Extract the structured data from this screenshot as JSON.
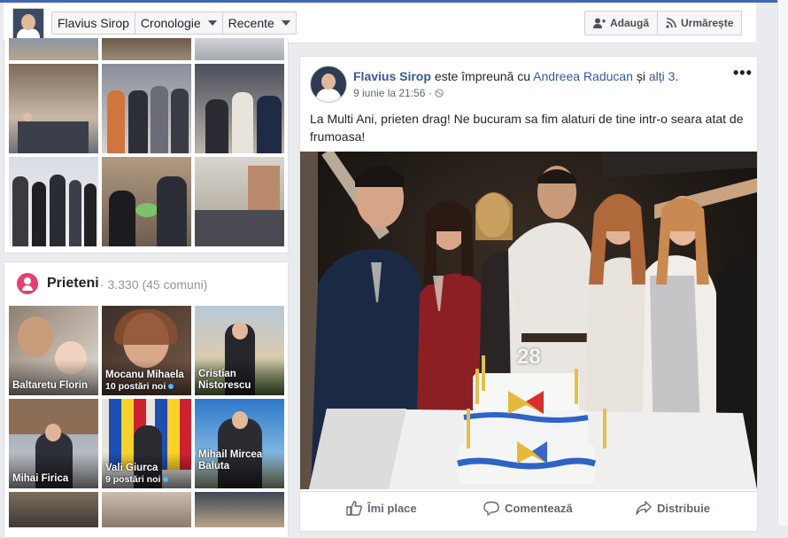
{
  "header": {
    "profile_name": "Flavius Sirop",
    "timeline_label": "Cronologie",
    "recent_label": "Recente",
    "add_friend_label": "Adaugă",
    "follow_label": "Urmărește"
  },
  "friends": {
    "title": "Prieteni",
    "count": "· 3.330 (45 comuni)",
    "items": [
      {
        "name": "Baltaretu Florin",
        "sub": ""
      },
      {
        "name": "Mocanu Mihaela",
        "sub": "10 postări noi"
      },
      {
        "name": "Cristian Nistorescu",
        "sub": ""
      },
      {
        "name": "Mihai Firica",
        "sub": ""
      },
      {
        "name": "Vali Giurca",
        "sub": "9 postări noi"
      },
      {
        "name": "Mihail Mircea Baluta",
        "sub": ""
      }
    ]
  },
  "post": {
    "author": "Flavius Sirop",
    "with_text": "este împreună cu",
    "tagged": "Andreea Raducan",
    "and_text": "și",
    "others": "alți 3",
    "time": "9 iunie la 21:56 · ",
    "text": "La Multi Ani, prieten drag! Ne bucuram sa fim alaturi de tine intr-o seara atat de frumoasa!",
    "cake_number": "28",
    "more": "•••",
    "actions": {
      "like": "Îmi place",
      "comment": "Comentează",
      "share": "Distribuie"
    }
  },
  "icons": {
    "add_friend": "add-friend-icon",
    "follow": "rss-icon",
    "privacy": "globe-icon",
    "like": "thumbs-up-icon",
    "comment": "speech-bubble-icon",
    "share": "share-arrow-icon"
  },
  "colors": {
    "accent": "#4267b2",
    "link": "#365899",
    "friends_icon": "#e43f6f"
  }
}
